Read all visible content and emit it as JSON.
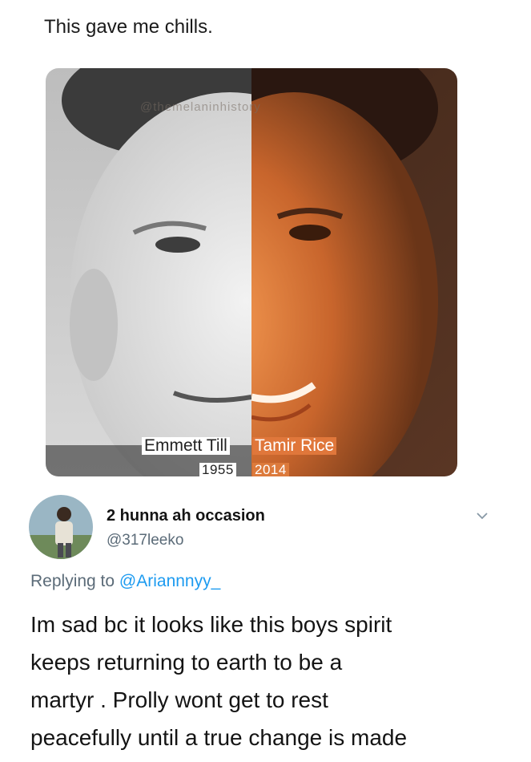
{
  "caption": "This gave me chills.",
  "image": {
    "watermark": "@themelaninhistory",
    "left_label": {
      "name": "Emmett Till",
      "year": "1955"
    },
    "right_label": {
      "name": "Tamir Rice",
      "year": "2014"
    }
  },
  "tweet": {
    "display_name": "2 hunna ah occasion",
    "handle": "@317leeko",
    "replying_prefix": "Replying to ",
    "replying_to": "@Ariannnyy_",
    "text_lines": [
      "Im sad bc it looks like this boys spirit",
      "keeps returning to earth to be a",
      "martyr . Prolly wont get to rest",
      "peacefully until a true change is made"
    ]
  }
}
